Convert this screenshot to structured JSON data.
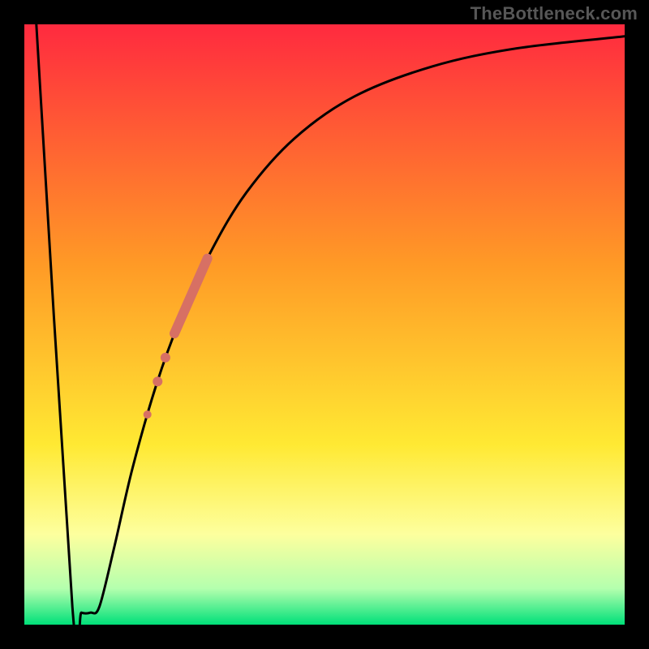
{
  "watermark": "TheBottleneck.com",
  "chart_data": {
    "type": "line",
    "title": "",
    "xlabel": "",
    "ylabel": "",
    "xlim": [
      0,
      100
    ],
    "ylim": [
      0,
      100
    ],
    "grid": false,
    "legend": false,
    "background_gradient": {
      "stops": [
        {
          "offset": 0.0,
          "color": "#ff2a3f"
        },
        {
          "offset": 0.4,
          "color": "#ff9a26"
        },
        {
          "offset": 0.7,
          "color": "#ffe933"
        },
        {
          "offset": 0.85,
          "color": "#fdff9e"
        },
        {
          "offset": 0.94,
          "color": "#b4ffae"
        },
        {
          "offset": 1.0,
          "color": "#00e079"
        }
      ]
    },
    "series": [
      {
        "name": "bottleneck-curve",
        "color": "#000000",
        "points": [
          {
            "x": 2.0,
            "y": 100.0
          },
          {
            "x": 8.0,
            "y": 3.0
          },
          {
            "x": 9.5,
            "y": 2.0
          },
          {
            "x": 11.0,
            "y": 2.0
          },
          {
            "x": 12.5,
            "y": 3.0
          },
          {
            "x": 15.0,
            "y": 13.0
          },
          {
            "x": 18.0,
            "y": 26.0
          },
          {
            "x": 22.0,
            "y": 40.0
          },
          {
            "x": 26.0,
            "y": 51.0
          },
          {
            "x": 31.0,
            "y": 62.0
          },
          {
            "x": 37.0,
            "y": 72.0
          },
          {
            "x": 45.0,
            "y": 81.0
          },
          {
            "x": 55.0,
            "y": 88.0
          },
          {
            "x": 68.0,
            "y": 93.0
          },
          {
            "x": 82.0,
            "y": 96.0
          },
          {
            "x": 100.0,
            "y": 98.0
          }
        ]
      }
    ],
    "markers": {
      "name": "highlight-segment",
      "color": "#d77064",
      "items": [
        {
          "type": "thick-segment",
          "x1": 25.0,
          "y1": 48.5,
          "x2": 30.5,
          "y2": 61.0,
          "width": 12
        },
        {
          "type": "dot",
          "x": 23.5,
          "y": 44.5,
          "r": 6
        },
        {
          "type": "dot",
          "x": 22.2,
          "y": 40.5,
          "r": 6
        },
        {
          "type": "dot",
          "x": 20.5,
          "y": 35.0,
          "r": 5
        }
      ]
    }
  }
}
